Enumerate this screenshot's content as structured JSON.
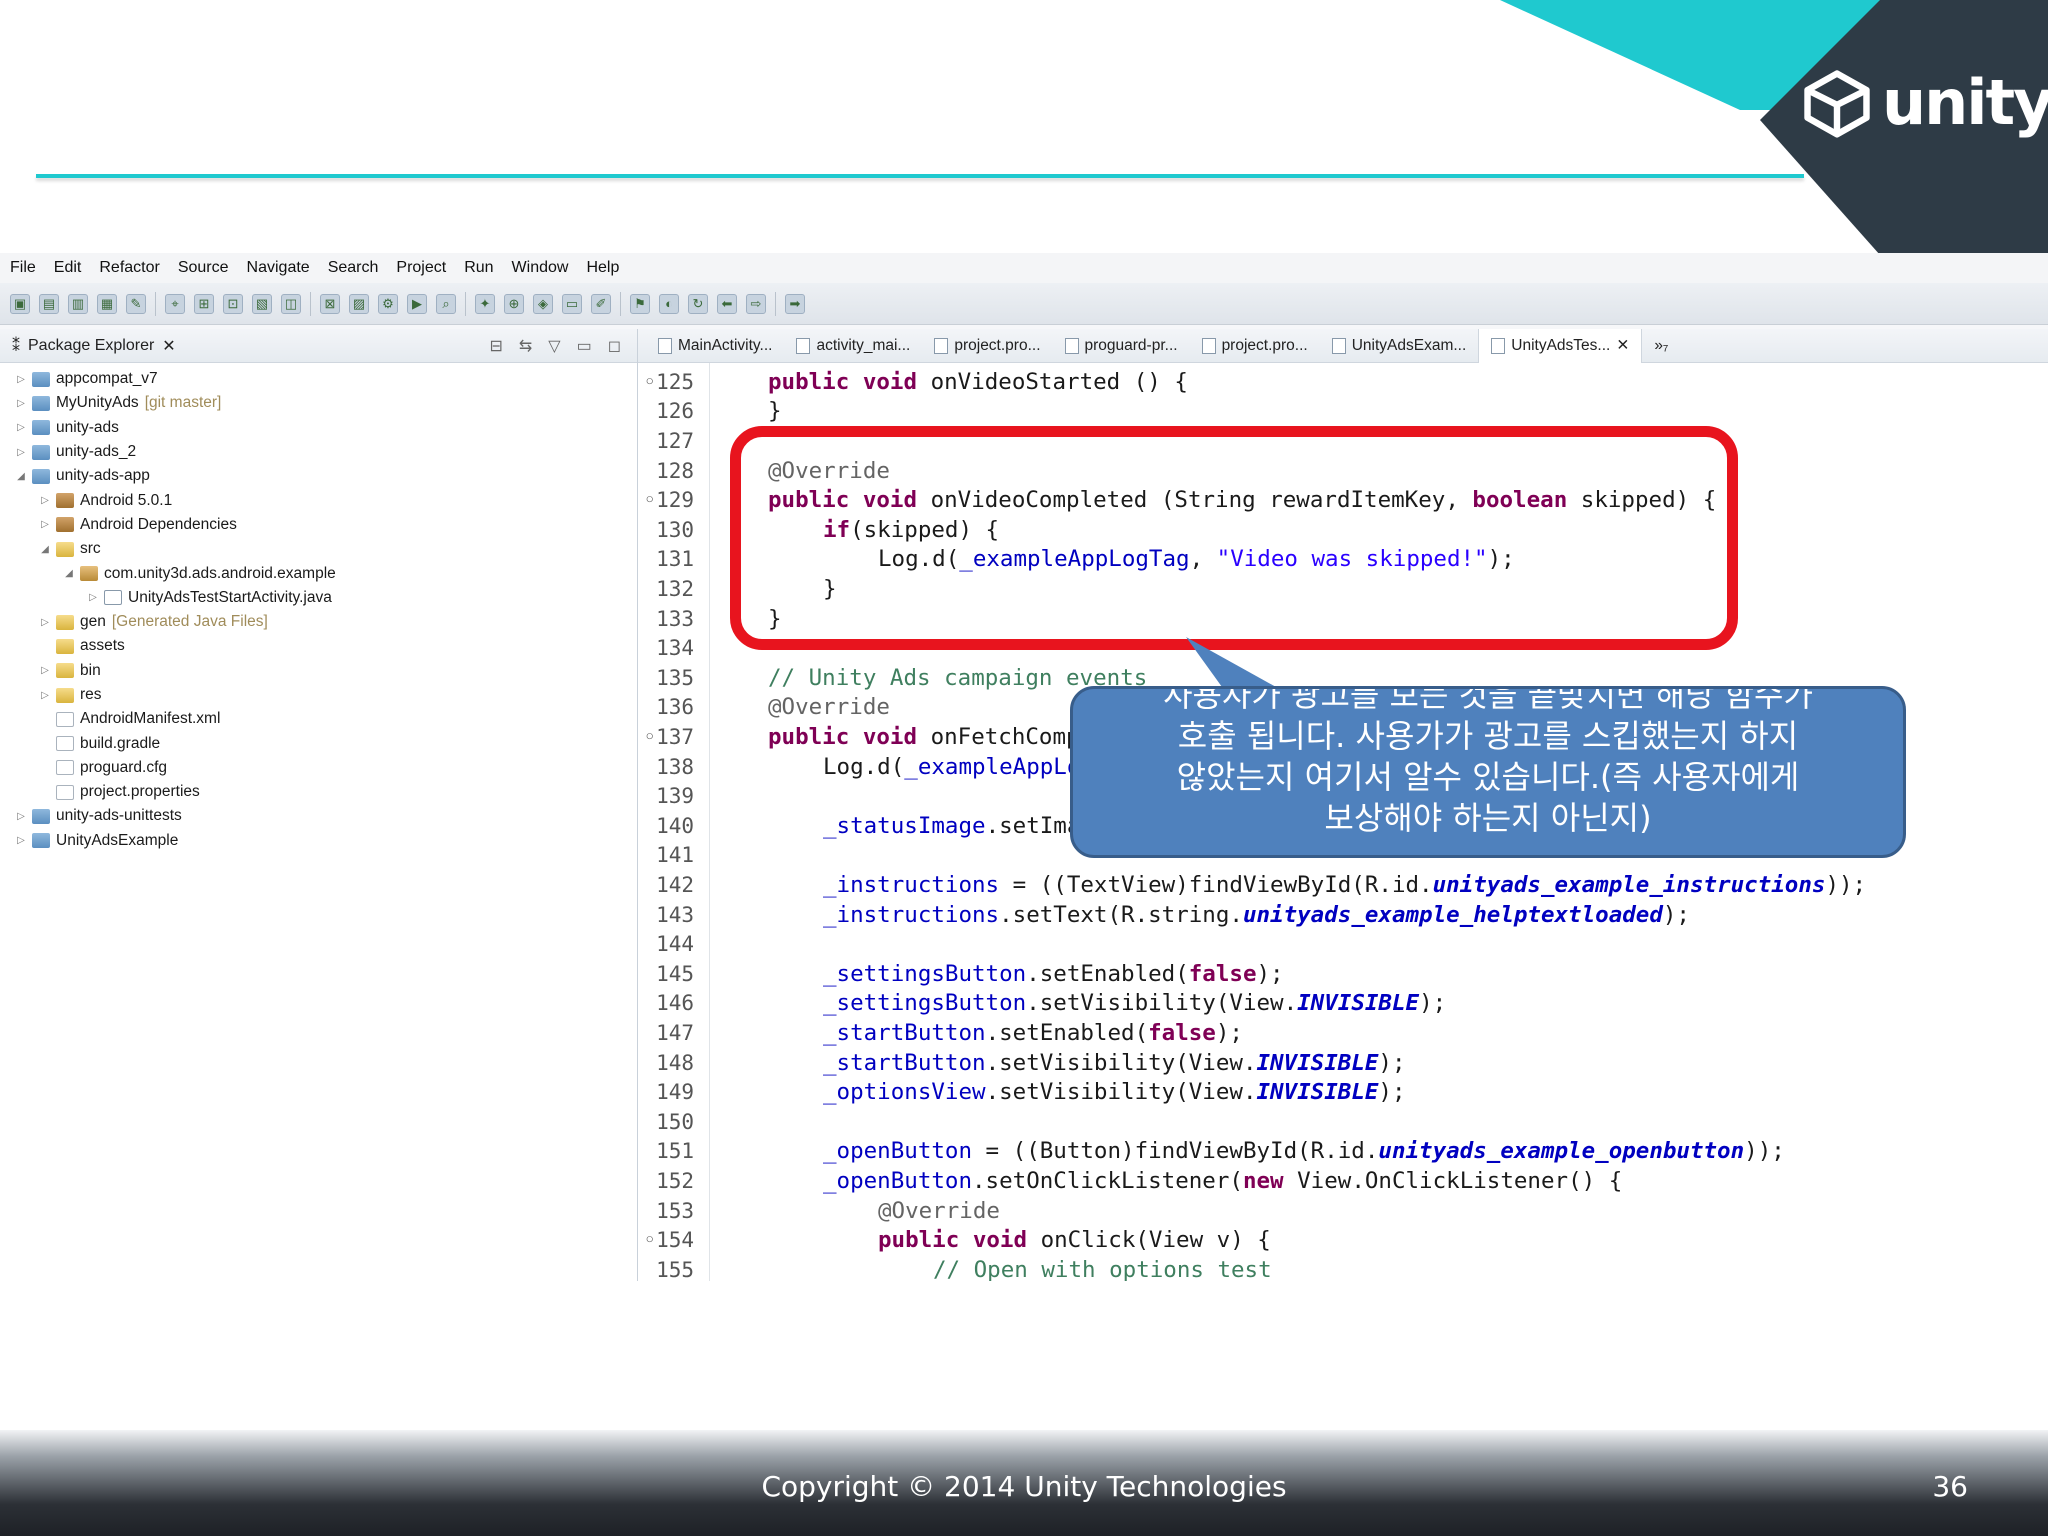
{
  "slide": {
    "logo_text": "unity",
    "copyright": "Copyright © 2014 Unity Technologies",
    "page_number": "36"
  },
  "colors": {
    "accent_teal": "#1fc9cf",
    "dark_slate": "#2e3b46",
    "highlight_red": "#e8141e",
    "callout_blue": "#4f81bd"
  },
  "ide": {
    "menu": [
      "File",
      "Edit",
      "Refactor",
      "Source",
      "Navigate",
      "Search",
      "Project",
      "Run",
      "Window",
      "Help"
    ],
    "explorer": {
      "title": "Package Explorer",
      "items": [
        {
          "label": "appcompat_v7",
          "suffix": "",
          "depth": 0,
          "twisty": "▷",
          "icon": "project"
        },
        {
          "label": "MyUnityAds",
          "suffix": "[git master]",
          "depth": 0,
          "twisty": "▷",
          "icon": "project"
        },
        {
          "label": "unity-ads",
          "suffix": "",
          "depth": 0,
          "twisty": "▷",
          "icon": "project"
        },
        {
          "label": "unity-ads_2",
          "suffix": "",
          "depth": 0,
          "twisty": "▷",
          "icon": "project"
        },
        {
          "label": "unity-ads-app",
          "suffix": "",
          "depth": 0,
          "twisty": "◢",
          "icon": "project"
        },
        {
          "label": "Android 5.0.1",
          "suffix": "",
          "depth": 1,
          "twisty": "▷",
          "icon": "lib"
        },
        {
          "label": "Android Dependencies",
          "suffix": "",
          "depth": 1,
          "twisty": "▷",
          "icon": "lib"
        },
        {
          "label": "src",
          "suffix": "",
          "depth": 1,
          "twisty": "◢",
          "icon": "folder"
        },
        {
          "label": "com.unity3d.ads.android.example",
          "suffix": "",
          "depth": 2,
          "twisty": "◢",
          "icon": "pkg"
        },
        {
          "label": "UnityAdsTestStartActivity.java",
          "suffix": "",
          "depth": 3,
          "twisty": "▷",
          "icon": "java"
        },
        {
          "label": "gen",
          "suffix": "[Generated Java Files]",
          "depth": 1,
          "twisty": "▷",
          "icon": "folder"
        },
        {
          "label": "assets",
          "suffix": "",
          "depth": 1,
          "twisty": "",
          "icon": "folder"
        },
        {
          "label": "bin",
          "suffix": "",
          "depth": 1,
          "twisty": "▷",
          "icon": "folder"
        },
        {
          "label": "res",
          "suffix": "",
          "depth": 1,
          "twisty": "▷",
          "icon": "folder"
        },
        {
          "label": "AndroidManifest.xml",
          "suffix": "",
          "depth": 1,
          "twisty": "",
          "icon": "file"
        },
        {
          "label": "build.gradle",
          "suffix": "",
          "depth": 1,
          "twisty": "",
          "icon": "file"
        },
        {
          "label": "proguard.cfg",
          "suffix": "",
          "depth": 1,
          "twisty": "",
          "icon": "file"
        },
        {
          "label": "project.properties",
          "suffix": "",
          "depth": 1,
          "twisty": "",
          "icon": "file"
        },
        {
          "label": "unity-ads-unittests",
          "suffix": "",
          "depth": 0,
          "twisty": "▷",
          "icon": "project"
        },
        {
          "label": "UnityAdsExample",
          "suffix": "",
          "depth": 0,
          "twisty": "▷",
          "icon": "project"
        }
      ]
    },
    "tabs": [
      {
        "label": "MainActivity...",
        "active": false
      },
      {
        "label": "activity_mai...",
        "active": false
      },
      {
        "label": "project.pro...",
        "active": false
      },
      {
        "label": "proguard-pr...",
        "active": false
      },
      {
        "label": "project.pro...",
        "active": false
      },
      {
        "label": "UnityAdsExam...",
        "active": false
      },
      {
        "label": "UnityAdsTes...",
        "active": true
      }
    ],
    "tab_overflow": "»₇",
    "code_lines": [
      {
        "n": "125",
        "m": "◦",
        "indent": 0,
        "tokens": [
          [
            "kw",
            "public void"
          ],
          [
            "",
            "onVideoStarted () {"
          ]
        ]
      },
      {
        "n": "126",
        "m": "",
        "indent": 0,
        "tokens": [
          [
            "",
            "}"
          ]
        ]
      },
      {
        "n": "127",
        "m": "",
        "indent": 0,
        "tokens": []
      },
      {
        "n": "128",
        "m": "",
        "indent": 0,
        "tokens": [
          [
            "ann",
            "@Override"
          ]
        ]
      },
      {
        "n": "129",
        "m": "◦",
        "indent": 0,
        "tokens": [
          [
            "kw",
            "public void"
          ],
          [
            "",
            "onVideoCompleted (String rewardItemKey, "
          ],
          [
            "kw",
            "boolean"
          ],
          [
            "",
            " skipped) {"
          ]
        ]
      },
      {
        "n": "130",
        "m": "",
        "indent": 1,
        "tokens": [
          [
            "kw",
            "if"
          ],
          [
            "",
            "(skipped) {"
          ]
        ]
      },
      {
        "n": "131",
        "m": "",
        "indent": 2,
        "tokens": [
          [
            "",
            "Log.d("
          ],
          [
            "fld",
            "_exampleAppLogTag"
          ],
          [
            "",
            ", "
          ],
          [
            "str",
            "\"Video was skipped!\""
          ],
          [
            "",
            ");"
          ]
        ]
      },
      {
        "n": "132",
        "m": "",
        "indent": 1,
        "tokens": [
          [
            "",
            "}"
          ]
        ]
      },
      {
        "n": "133",
        "m": "",
        "indent": 0,
        "tokens": [
          [
            "",
            "}"
          ]
        ]
      },
      {
        "n": "134",
        "m": "",
        "indent": 0,
        "tokens": []
      },
      {
        "n": "135",
        "m": "",
        "indent": 0,
        "tokens": [
          [
            "cm",
            "// Unity Ads campaign events"
          ]
        ]
      },
      {
        "n": "136",
        "m": "",
        "indent": 0,
        "tokens": [
          [
            "ann",
            "@Override"
          ]
        ]
      },
      {
        "n": "137",
        "m": "◦",
        "indent": 0,
        "tokens": [
          [
            "kw",
            "public void"
          ],
          [
            "",
            "onFetchCompleted () {"
          ]
        ]
      },
      {
        "n": "138",
        "m": "",
        "indent": 1,
        "tokens": [
          [
            "",
            "Log.d("
          ],
          [
            "fld",
            "_exampleAppLogTag"
          ],
          [
            "",
            ", "
          ]
        ]
      },
      {
        "n": "139",
        "m": "",
        "indent": 0,
        "tokens": []
      },
      {
        "n": "140",
        "m": "",
        "indent": 1,
        "tokens": [
          [
            "fld",
            "_statusImage"
          ],
          [
            "",
            ".setImageResource();"
          ]
        ]
      },
      {
        "n": "141",
        "m": "",
        "indent": 0,
        "tokens": []
      },
      {
        "n": "142",
        "m": "",
        "indent": 1,
        "tokens": [
          [
            "fld",
            "_instructions"
          ],
          [
            "",
            " = ((TextView)findViewById(R.id."
          ],
          [
            "sfi",
            "unityads_example_instructions"
          ],
          [
            "",
            "));"
          ]
        ]
      },
      {
        "n": "143",
        "m": "",
        "indent": 1,
        "tokens": [
          [
            "fld",
            "_instructions"
          ],
          [
            "",
            ".setText(R.string."
          ],
          [
            "sfi",
            "unityads_example_helptextloaded"
          ],
          [
            "",
            ");"
          ]
        ]
      },
      {
        "n": "144",
        "m": "",
        "indent": 0,
        "tokens": []
      },
      {
        "n": "145",
        "m": "",
        "indent": 1,
        "tokens": [
          [
            "fld",
            "_settingsButton"
          ],
          [
            "",
            ".setEnabled("
          ],
          [
            "kw",
            "false"
          ],
          [
            "",
            ");"
          ]
        ]
      },
      {
        "n": "146",
        "m": "",
        "indent": 1,
        "tokens": [
          [
            "fld",
            "_settingsButton"
          ],
          [
            "",
            ".setVisibility(View."
          ],
          [
            "sfi",
            "INVISIBLE"
          ],
          [
            "",
            ");"
          ]
        ]
      },
      {
        "n": "147",
        "m": "",
        "indent": 1,
        "tokens": [
          [
            "fld",
            "_startButton"
          ],
          [
            "",
            ".setEnabled("
          ],
          [
            "kw",
            "false"
          ],
          [
            "",
            ");"
          ]
        ]
      },
      {
        "n": "148",
        "m": "",
        "indent": 1,
        "tokens": [
          [
            "fld",
            "_startButton"
          ],
          [
            "",
            ".setVisibility(View."
          ],
          [
            "sfi",
            "INVISIBLE"
          ],
          [
            "",
            ");"
          ]
        ]
      },
      {
        "n": "149",
        "m": "",
        "indent": 1,
        "tokens": [
          [
            "fld",
            "_optionsView"
          ],
          [
            "",
            ".setVisibility(View."
          ],
          [
            "sfi",
            "INVISIBLE"
          ],
          [
            "",
            ");"
          ]
        ]
      },
      {
        "n": "150",
        "m": "",
        "indent": 0,
        "tokens": []
      },
      {
        "n": "151",
        "m": "",
        "indent": 1,
        "tokens": [
          [
            "fld",
            "_openButton"
          ],
          [
            "",
            " = ((Button)findViewById(R.id."
          ],
          [
            "sfi",
            "unityads_example_openbutton"
          ],
          [
            "",
            "));"
          ]
        ]
      },
      {
        "n": "152",
        "m": "",
        "indent": 1,
        "tokens": [
          [
            "fld",
            "_openButton"
          ],
          [
            "",
            ".setOnClickListener("
          ],
          [
            "kw",
            "new"
          ],
          [
            "",
            " View.OnClickListener() {"
          ]
        ]
      },
      {
        "n": "153",
        "m": "",
        "indent": 2,
        "tokens": [
          [
            "ann",
            "@Override"
          ]
        ]
      },
      {
        "n": "154",
        "m": "◦",
        "indent": 2,
        "tokens": [
          [
            "kw",
            "public void"
          ],
          [
            "",
            "onClick(View v) {"
          ]
        ]
      },
      {
        "n": "155",
        "m": "",
        "indent": 3,
        "tokens": [
          [
            "cm",
            "// Open with options test"
          ]
        ]
      }
    ]
  },
  "callout": {
    "lines": [
      "사용자가 광고를 보는 것을 끝맞치면 해당 함수가",
      "호출 됩니다. 사용가가 광고를 스킵했는지 하지",
      "않았는지 여기서 알수 있습니다.(즉 사용자에게",
      "보상해야 하는지 아닌지)"
    ]
  }
}
